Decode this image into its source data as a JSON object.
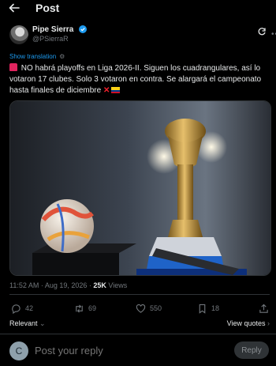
{
  "header": {
    "title": "Post",
    "back_icon": "arrow-left-icon"
  },
  "author": {
    "name": "Pipe Sierra",
    "handle": "@PSierraR",
    "verified": true
  },
  "translate": {
    "label": "Show translation"
  },
  "tweet": {
    "line": "NO habrá playoffs en Liga 2026-II. Siguen los cuadrangulares, así lo votaron 17 clubes. Solo 3 votaron en contra. Se alargará el campeonato hasta finales de diciembre"
  },
  "meta": {
    "time": "11:52 AM · Aug 19, 2026 · ",
    "views_count": "25K",
    "views_label": " Views"
  },
  "actions": {
    "replies": "42",
    "reposts": "69",
    "likes": "550",
    "bookmarks": "18"
  },
  "sort": {
    "relevant": "Relevant",
    "view_quotes": "View quotes"
  },
  "reply": {
    "avatar_letter": "C",
    "placeholder": "Post your reply",
    "button": "Reply"
  },
  "colors": {
    "accent": "#1d9bf0",
    "background": "#000000",
    "muted": "#71767b"
  }
}
